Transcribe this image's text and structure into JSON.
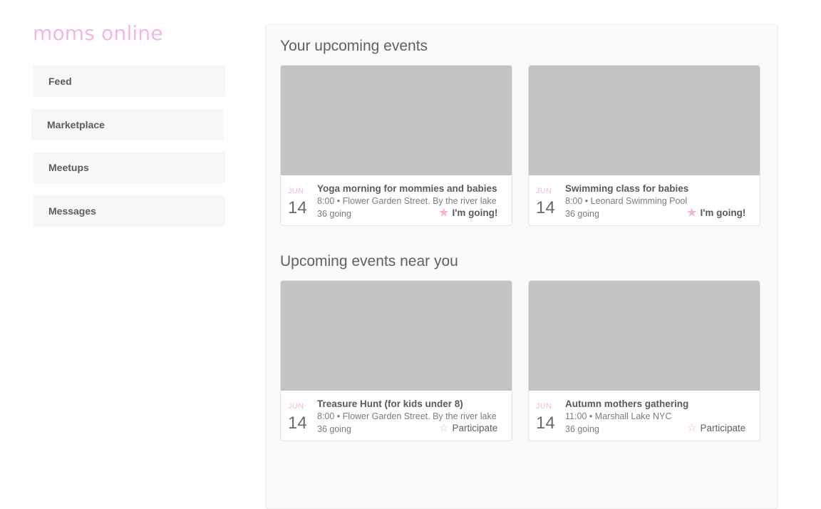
{
  "app": {
    "logo_text": "moms online",
    "brand_color": "#f4b8de"
  },
  "sidebar": {
    "items": [
      {
        "label": "Feed"
      },
      {
        "label": "Marketplace"
      },
      {
        "label": "Meetups"
      },
      {
        "label": "Messages"
      }
    ]
  },
  "upcoming": {
    "title": "Your upcoming events",
    "events": [
      {
        "month": "JUN",
        "day": "14",
        "title": "Yoga morning for mommies and babies",
        "detail": "8:00 • Flower Garden Street. By the river lake",
        "going": "36 going",
        "action_icon": "star-filled-icon",
        "action_label": "I'm going!"
      },
      {
        "month": "JUN",
        "day": "14",
        "title": "Swimming class for babies",
        "detail": "8:00 • Leonard Swimming Pool",
        "going": "36 going",
        "action_icon": "star-filled-icon",
        "action_label": "I'm going!"
      }
    ]
  },
  "nearby": {
    "title": "Upcoming events near you",
    "events": [
      {
        "month": "JUN",
        "day": "14",
        "title": "Treasure Hunt (for kids under 8)",
        "detail": "8:00 • Flower Garden Street. By the river lake",
        "going": "36 going",
        "action_icon": "star-outline-icon",
        "action_label": "Participate"
      },
      {
        "month": "JUN",
        "day": "14",
        "title": "Autumn mothers gathering",
        "detail": "11:00 • Marshall Lake NYC",
        "going": "36 going",
        "action_icon": "star-outline-icon",
        "action_label": "Participate"
      }
    ]
  }
}
